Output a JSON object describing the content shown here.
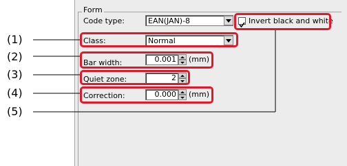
{
  "form": {
    "legend": "Form",
    "code_type_label": "Code type:",
    "code_type_value": "EAN(JAN)-8",
    "invert_label": "Invert black and white",
    "invert_checked": true,
    "class_label": "Class:",
    "class_value": "Normal",
    "bar_width_label": "Bar width:",
    "bar_width_value": "0.001",
    "bar_width_unit": "(mm)",
    "quiet_zone_label": "Quiet zone:",
    "quiet_zone_value": "2",
    "correction_label": "Correction:",
    "correction_value": "0.000",
    "correction_unit": "(mm)"
  },
  "callouts": [
    "(1)",
    "(2)",
    "(3)",
    "(4)",
    "(5)"
  ],
  "colors": {
    "highlight": "#e0182a",
    "panel": "#ececec"
  }
}
